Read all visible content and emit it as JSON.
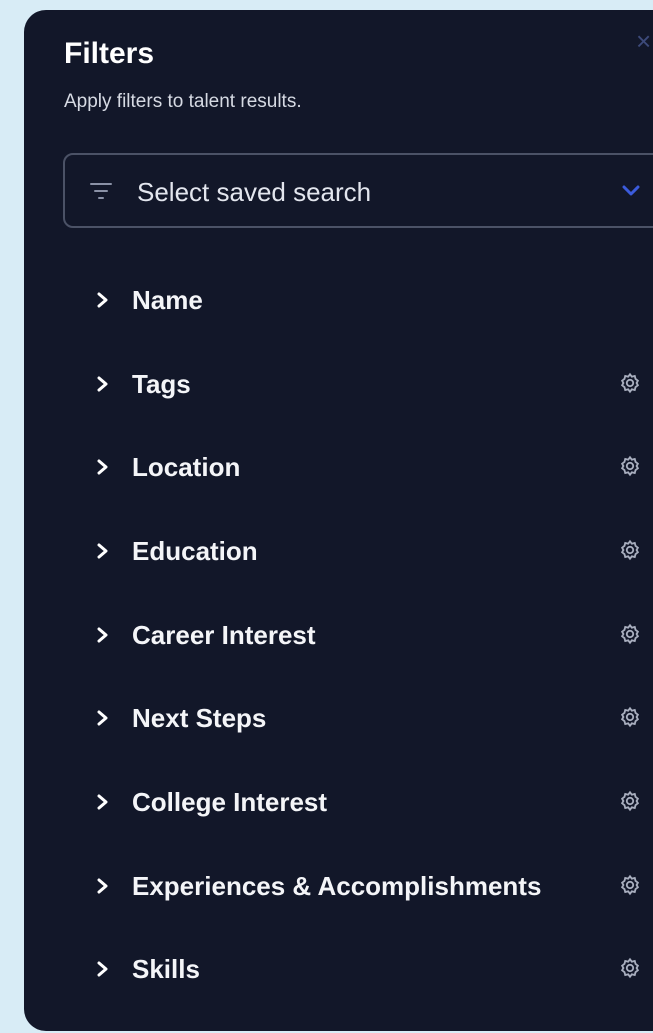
{
  "panel": {
    "title": "Filters",
    "subtitle": "Apply filters to talent results."
  },
  "saved_search": {
    "placeholder": "Select saved search",
    "icon": "filter-icon",
    "dropdown_icon": "chevron-down-icon"
  },
  "filters": [
    {
      "label": "Name",
      "settings_icon": false
    },
    {
      "label": "Tags",
      "settings_icon": true
    },
    {
      "label": "Location",
      "settings_icon": true
    },
    {
      "label": "Education",
      "settings_icon": true
    },
    {
      "label": "Career Interest",
      "settings_icon": true
    },
    {
      "label": "Next Steps",
      "settings_icon": true
    },
    {
      "label": "College Interest",
      "settings_icon": true
    },
    {
      "label": "Experiences & Accomplishments",
      "settings_icon": true
    },
    {
      "label": "Skills",
      "settings_icon": true
    }
  ],
  "colors": {
    "panel_bg": "#121729",
    "page_bg": "#d8ecf6",
    "accent": "#3b5bdb",
    "text": "#ffffff"
  }
}
